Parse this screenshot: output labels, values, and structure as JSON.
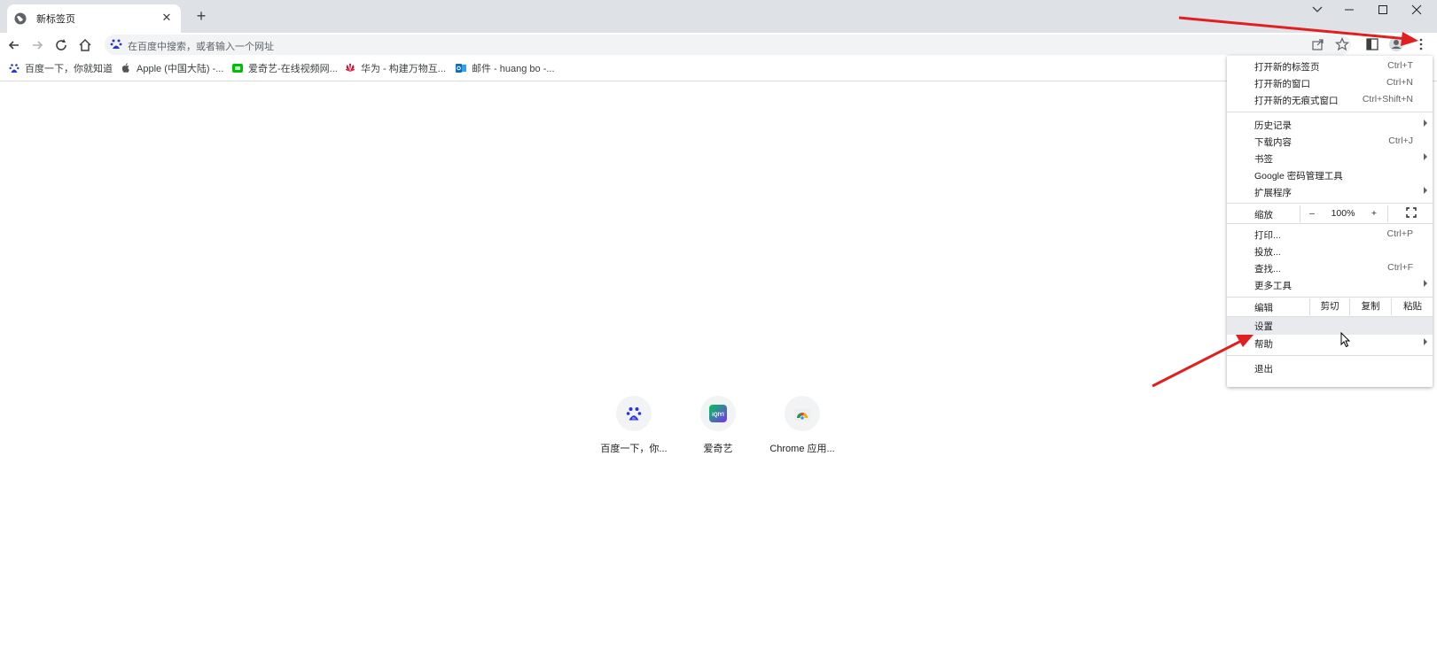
{
  "tab": {
    "title": "新标签页",
    "close": "✕"
  },
  "newtab_label": "+",
  "window": {
    "dropdown": "⌄",
    "minimize": "–",
    "maximize": "☐",
    "close": "✕"
  },
  "omnibox": {
    "placeholder": "在百度中搜索，或者输入一个网址"
  },
  "bookmarks": [
    {
      "label": "百度一下，你就知道",
      "icon": "baidu-icon"
    },
    {
      "label": "Apple (中国大陆) -...",
      "icon": "apple-icon"
    },
    {
      "label": "爱奇艺-在线视频网...",
      "icon": "iqiyi-icon"
    },
    {
      "label": "华为 - 构建万物互...",
      "icon": "huawei-icon"
    },
    {
      "label": "邮件 - huang bo -...",
      "icon": "outlook-icon"
    }
  ],
  "shortcuts": [
    {
      "label": "百度一下，你...",
      "icon": "baidu-icon"
    },
    {
      "label": "爱奇艺",
      "icon": "iqiyi-icon"
    },
    {
      "label": "Chrome 应用...",
      "icon": "chrome-web-store-icon"
    }
  ],
  "menu": {
    "new_tab": {
      "label": "打开新的标签页",
      "shortcut": "Ctrl+T"
    },
    "new_window": {
      "label": "打开新的窗口",
      "shortcut": "Ctrl+N"
    },
    "incognito": {
      "label": "打开新的无痕式窗口",
      "shortcut": "Ctrl+Shift+N"
    },
    "history": {
      "label": "历史记录"
    },
    "downloads": {
      "label": "下载内容",
      "shortcut": "Ctrl+J"
    },
    "bookmarks": {
      "label": "书签"
    },
    "password_manager": {
      "label": "Google 密码管理工具"
    },
    "extensions": {
      "label": "扩展程序"
    },
    "zoom": {
      "label": "缩放",
      "minus": "–",
      "value": "100%",
      "plus": "+"
    },
    "print": {
      "label": "打印...",
      "shortcut": "Ctrl+P"
    },
    "cast": {
      "label": "投放..."
    },
    "find": {
      "label": "查找...",
      "shortcut": "Ctrl+F"
    },
    "more_tools": {
      "label": "更多工具"
    },
    "edit": {
      "label": "编辑",
      "cut": "剪切",
      "copy": "复制",
      "paste": "粘贴"
    },
    "settings": {
      "label": "设置"
    },
    "help": {
      "label": "帮助"
    },
    "exit": {
      "label": "退出"
    }
  },
  "colors": {
    "annotation_arrow": "#e02020",
    "menu_hover": "#e8eaed",
    "omnibox_bg": "#f1f3f4"
  }
}
